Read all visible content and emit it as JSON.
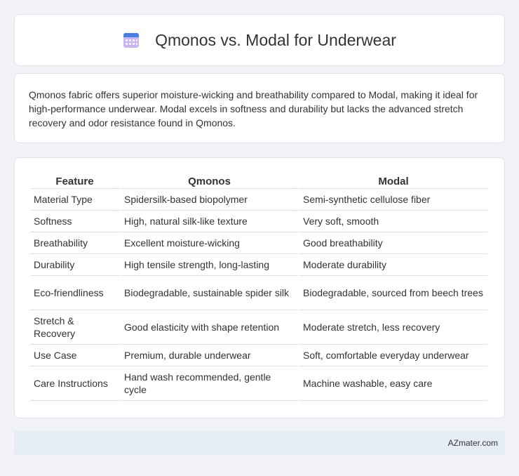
{
  "header": {
    "title": "Qmonos vs. Modal for Underwear",
    "icon": "calendar-icon"
  },
  "summary": "Qmonos fabric offers superior moisture-wicking and breathability compared to Modal, making it ideal for high-performance underwear. Modal excels in softness and durability but lacks the advanced stretch recovery and odor resistance found in Qmonos.",
  "table": {
    "columns": [
      "Feature",
      "Qmonos",
      "Modal"
    ],
    "rows": [
      [
        "Material Type",
        "Spidersilk-based biopolymer",
        "Semi-synthetic cellulose fiber"
      ],
      [
        "Softness",
        "High, natural silk-like texture",
        "Very soft, smooth"
      ],
      [
        "Breathability",
        "Excellent moisture-wicking",
        "Good breathability"
      ],
      [
        "Durability",
        "High tensile strength, long-lasting",
        "Moderate durability"
      ],
      [
        "Eco-friendliness",
        "Biodegradable, sustainable spider silk",
        "Biodegradable, sourced from beech trees"
      ],
      [
        "Stretch & Recovery",
        "Good elasticity with shape retention",
        "Moderate stretch, less recovery"
      ],
      [
        "Use Case",
        "Premium, durable underwear",
        "Soft, comfortable everyday underwear"
      ],
      [
        "Care Instructions",
        "Hand wash recommended, gentle cycle",
        "Machine washable, easy care"
      ]
    ]
  },
  "footer": {
    "text": "AZmater.com"
  },
  "colors": {
    "background": "#f0f2f7",
    "card": "#ffffff",
    "footer_bg": "#e7edf7",
    "icon_header": "#4a7fe0",
    "icon_body": "#c9b6ef"
  }
}
